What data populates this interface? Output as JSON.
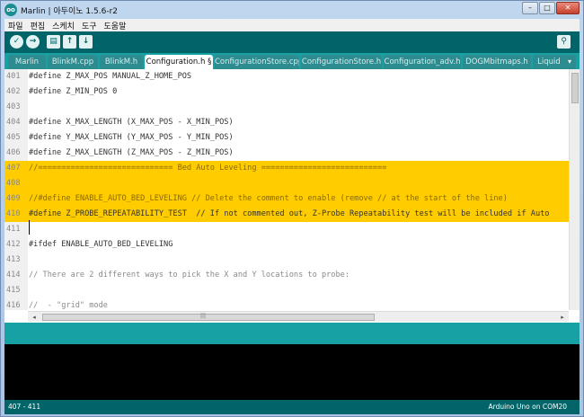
{
  "window": {
    "app_icon": "oo",
    "title": "Marlin | 아두이노 1.5.6-r2",
    "controls": {
      "minimize": "–",
      "maximize": "□",
      "close": "✕"
    }
  },
  "menu": [
    "파일",
    "편집",
    "스케치",
    "도구",
    "도움말"
  ],
  "toolbar": {
    "verify_icon": "✓",
    "upload_icon": "→",
    "new_icon": "▤",
    "open_icon": "↑",
    "save_icon": "↓",
    "serial_monitor_icon": "⚲"
  },
  "tabs": [
    {
      "label": "Marlin",
      "active": false
    },
    {
      "label": "BlinkM.cpp",
      "active": false
    },
    {
      "label": "BlinkM.h",
      "active": false
    },
    {
      "label": "Configuration.h §",
      "active": true
    },
    {
      "label": "ConfigurationStore.cpp",
      "active": false
    },
    {
      "label": "ConfigurationStore.h",
      "active": false
    },
    {
      "label": "Configuration_adv.h",
      "active": false
    },
    {
      "label": "DOGMbitmaps.h",
      "active": false
    },
    {
      "label": "Liquid",
      "active": false
    }
  ],
  "tab_menu_icon": "▾",
  "editor": {
    "lines": [
      {
        "num": "401",
        "text": "#define Z_MAX_POS MANUAL_Z_HOME_POS",
        "highlight": false,
        "kind": "code"
      },
      {
        "num": "402",
        "text": "#define Z_MIN_POS 0",
        "highlight": false,
        "kind": "code"
      },
      {
        "num": "403",
        "text": "",
        "highlight": false,
        "kind": "code"
      },
      {
        "num": "404",
        "text": "#define X_MAX_LENGTH (X_MAX_POS - X_MIN_POS)",
        "highlight": false,
        "kind": "code"
      },
      {
        "num": "405",
        "text": "#define Y_MAX_LENGTH (Y_MAX_POS - Y_MIN_POS)",
        "highlight": false,
        "kind": "code"
      },
      {
        "num": "406",
        "text": "#define Z_MAX_LENGTH (Z_MAX_POS - Z_MIN_POS)",
        "highlight": false,
        "kind": "code"
      },
      {
        "num": "407",
        "text": "//============================= Bed Auto Leveling ===========================",
        "highlight": true,
        "kind": "comment"
      },
      {
        "num": "408",
        "text": "",
        "highlight": true,
        "kind": "code"
      },
      {
        "num": "409",
        "text": "//#define ENABLE_AUTO_BED_LEVELING // Delete the comment to enable (remove // at the start of the line)",
        "highlight": true,
        "kind": "comment"
      },
      {
        "num": "410",
        "text": "#define Z_PROBE_REPEATABILITY_TEST  // If not commented out, Z-Probe Repeatability test will be included if Auto",
        "highlight": true,
        "kind": "code"
      },
      {
        "num": "411",
        "text": "",
        "highlight": false,
        "kind": "code"
      },
      {
        "num": "412",
        "text": "#ifdef ENABLE_AUTO_BED_LEVELING",
        "highlight": false,
        "kind": "code"
      },
      {
        "num": "413",
        "text": "",
        "highlight": false,
        "kind": "code"
      },
      {
        "num": "414",
        "text": "// There are 2 different ways to pick the X and Y locations to probe:",
        "highlight": false,
        "kind": "comment"
      },
      {
        "num": "415",
        "text": "",
        "highlight": false,
        "kind": "code"
      },
      {
        "num": "416",
        "text": "//  - \"grid\" mode",
        "highlight": false,
        "kind": "comment"
      }
    ],
    "hscroll_left": "◂",
    "hscroll_right": "▸",
    "hscroll_grip": "|||"
  },
  "footer": {
    "line_range": "407 - 411",
    "board": "Arduino Uno on COM20"
  }
}
